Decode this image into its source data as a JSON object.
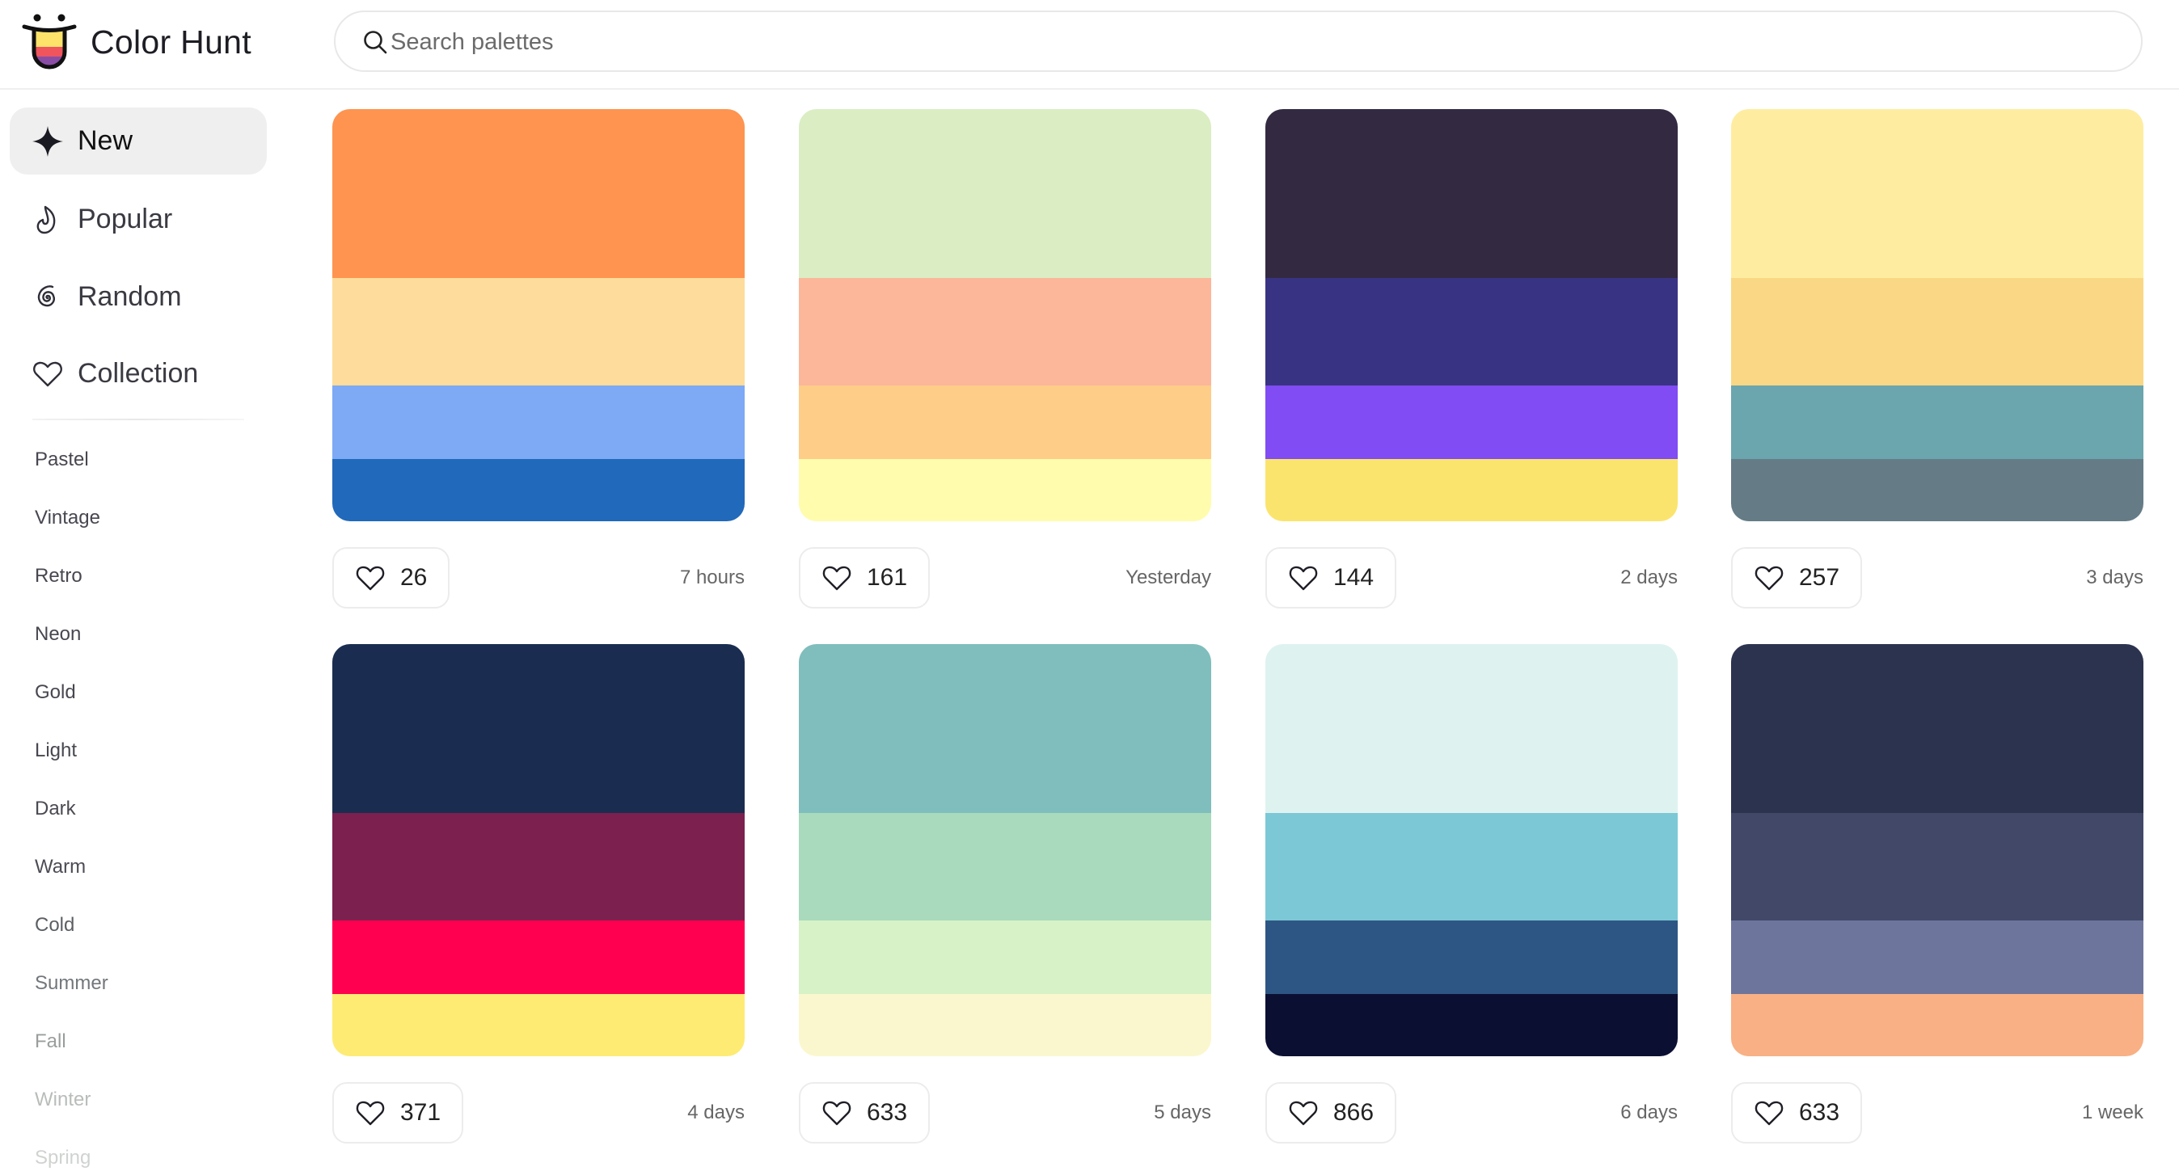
{
  "header": {
    "brand": "Color Hunt",
    "search": {
      "placeholder": "Search palettes",
      "value": ""
    }
  },
  "sidebar": {
    "nav": [
      {
        "label": "New",
        "icon": "sparkle-icon",
        "active": true
      },
      {
        "label": "Popular",
        "icon": "flame-icon",
        "active": false
      },
      {
        "label": "Random",
        "icon": "spiral-icon",
        "active": false
      },
      {
        "label": "Collection",
        "icon": "heart-icon",
        "active": false
      }
    ],
    "tags": [
      "Pastel",
      "Vintage",
      "Retro",
      "Neon",
      "Gold",
      "Light",
      "Dark",
      "Warm",
      "Cold",
      "Summer",
      "Fall",
      "Winter",
      "Spring"
    ]
  },
  "palettes": [
    {
      "colors": [
        "#FE9450",
        "#FEDC9B",
        "#7DA9F5",
        "#2169BA"
      ],
      "likes": "26",
      "time": "7 hours"
    },
    {
      "colors": [
        "#DBEDC3",
        "#FCB69A",
        "#FECD88",
        "#FFFCAE"
      ],
      "likes": "161",
      "time": "Yesterday"
    },
    {
      "colors": [
        "#332A42",
        "#393384",
        "#814CF3",
        "#FBE46D"
      ],
      "likes": "144",
      "time": "2 days"
    },
    {
      "colors": [
        "#FEEDA1",
        "#FAD784",
        "#6BA5AD",
        "#657C87"
      ],
      "likes": "257",
      "time": "3 days"
    },
    {
      "colors": [
        "#1A2D50",
        "#7C204F",
        "#FE004F",
        "#FEEB74"
      ],
      "likes": "371",
      "time": "4 days"
    },
    {
      "colors": [
        "#7FBEBC",
        "#A9DABD",
        "#D7F2C6",
        "#FAF7CF"
      ],
      "likes": "633",
      "time": "5 days"
    },
    {
      "colors": [
        "#DEF3F0",
        "#7CC8D6",
        "#2E5684",
        "#0B1033"
      ],
      "likes": "866",
      "time": "6 days"
    },
    {
      "colors": [
        "#2C334F",
        "#414868",
        "#6D759D",
        "#F8B084"
      ],
      "likes": "633",
      "time": "1 week"
    }
  ],
  "colors": {
    "active_bg": "#EFEFEF",
    "text_primary": "#1C1C22",
    "text_muted": "#666666",
    "border": "#ECECEC"
  }
}
